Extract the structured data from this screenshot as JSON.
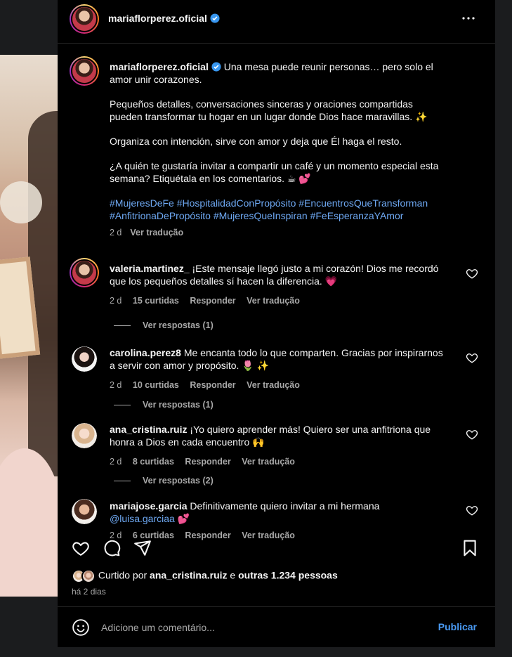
{
  "post": {
    "author": "mariaflorperez.oficial",
    "caption_line1": "Una mesa puede reunir personas… pero solo el amor unir corazones.",
    "caption_p2": "Pequeños detalles, conversaciones sinceras y oraciones compartidas pueden transformar tu hogar en un lugar donde Dios hace maravillas. ✨",
    "caption_p3": "Organiza con intención, sirve con amor y deja que Él haga el resto.",
    "caption_p4": "¿A quién te gustaría invitar a compartir un café y un momento especial esta semana? Etiquétala en los comentarios. ☕ 💕",
    "hashtags": "#MujeresDeFe #HospitalidadConPropósito #EncuentrosQueTransforman #AnfitrionaDePropósito #MujeresQueInspiran #FeEsperanzaYAmor",
    "age": "2 d",
    "see_translation": "Ver tradução"
  },
  "comments": [
    {
      "user": "valeria.martinez_",
      "text": "¡Este mensaje llegó justo a mi corazón! Dios me recordó que los pequeños detalles sí hacen la diferencia. 💗",
      "age": "2 d",
      "likes": "15 curtidas",
      "reply": "Responder",
      "translate": "Ver tradução",
      "replies": "Ver respostas (1)"
    },
    {
      "user": "carolina.perez8",
      "text": "Me encanta todo lo que comparten. Gracias por inspirarnos a servir con amor y propósito. 🌷 ✨",
      "age": "2 d",
      "likes": "10 curtidas",
      "reply": "Responder",
      "translate": "Ver tradução",
      "replies": "Ver respostas (1)"
    },
    {
      "user": "ana_cristina.ruiz",
      "text": "¡Yo quiero aprender más! Quiero ser una anfitriona que honra a Dios en cada encuentro 🙌",
      "age": "2 d",
      "likes": "8 curtidas",
      "reply": "Responder",
      "translate": "Ver tradução",
      "replies": "Ver respostas (2)"
    },
    {
      "user": "mariajose.garcia",
      "text": "Definitivamente quiero invitar a mi hermana ",
      "mention": "@luisa.garciaa",
      "emoji": " 💕",
      "age": "2 d",
      "likes": "6 curtidas",
      "reply": "Responder",
      "translate": "Ver tradução"
    }
  ],
  "likes_summary": {
    "prefix": "Curtido por ",
    "user": "ana_cristina.ruiz",
    "middle": " e ",
    "others": "outras 1.234 pessoas"
  },
  "posted_ago": "há 2 dias",
  "composer": {
    "placeholder": "Adicione um comentário...",
    "publish": "Publicar"
  }
}
